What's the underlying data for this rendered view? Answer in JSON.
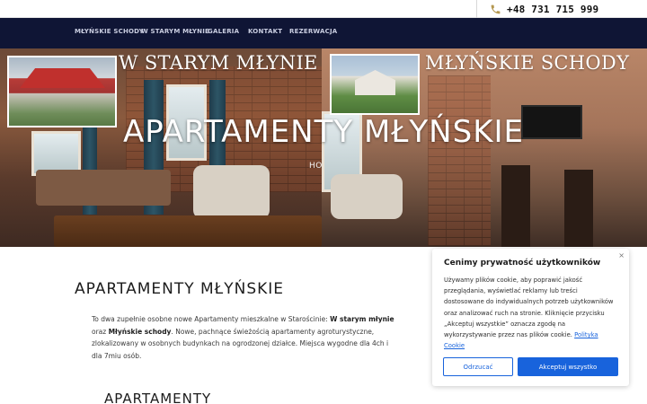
{
  "topbar": {
    "phone_icon": "phone-icon",
    "phone": "+48 731 715 999"
  },
  "nav": {
    "items": [
      {
        "label": "MŁYŃSKIE SCHODY"
      },
      {
        "label": "W STARYM MŁYNIE"
      },
      {
        "label": "GALERIA"
      },
      {
        "label": "KONTAKT"
      },
      {
        "label": "REZERWACJA"
      }
    ]
  },
  "hero": {
    "label_left": "W STARYM MŁYNIE",
    "label_right": "MŁYŃSKIE SCHODY",
    "title": "APARTAMENTY MŁYŃSKIE",
    "breadcrumb": "HO"
  },
  "content": {
    "title": "APARTAMENTY MŁYŃSKIE",
    "para_part1": "To dwa zupełnie osobne nowe Apartamenty mieszkalne w Starościnie: ",
    "para_bold1": "W starym młynie",
    "para_part2": " oraz ",
    "para_bold2": "Młyńskie schody",
    "para_part3": ". Nowe, pachnące świeżością apartamenty agroturystyczne, zlokalizowany w osobnych budynkach na ogrodzonej działce. Miejsca wygodne dla 4ch i dla 7miu osób.",
    "subtitle": "APARTAMENTY"
  },
  "cookie": {
    "close": "×",
    "heading": "Cenimy prywatność użytkowników",
    "body": "Używamy plików cookie, aby poprawić jakość przeglądania, wyświetlać reklamy lub treści dostosowane do indywidualnych potrzeb użytkowników oraz analizować ruch na stronie. Kliknięcie przycisku „Akceptuj wszystkie” oznacza zgodę na wykorzystywanie przez nas plików cookie. ",
    "link": "Polityka Cookie",
    "reject": "Odrzucać",
    "accept": "Akceptuj wszystko",
    "accent_color": "#1863dc"
  }
}
